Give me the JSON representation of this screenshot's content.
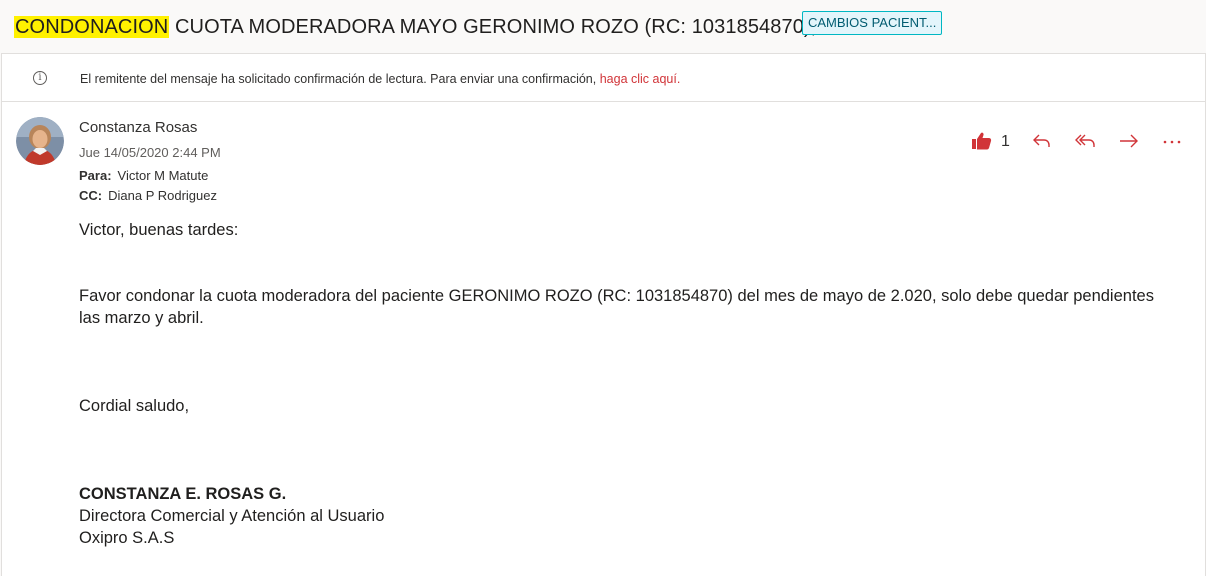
{
  "subject": {
    "highlight": "CONDONACION",
    "rest": " CUOTA MODERADORA MAYO GERONIMO ROZO (RC: 1031854870),",
    "category": "CAMBIOS PACIENT..."
  },
  "notice": {
    "icon": "info-icon",
    "text": "El remitente del mensaje ha solicitado confirmación de lectura. Para enviar una confirmación, ",
    "link": "haga clic aquí."
  },
  "message": {
    "sender": "Constanza Rosas",
    "date": "Jue 14/05/2020 2:44 PM",
    "to_label": "Para:",
    "to": "Victor M Matute",
    "cc_label": "CC:",
    "cc": "Diana P Rodriguez",
    "like_count": "1",
    "actions": [
      "like",
      "reply",
      "reply-all",
      "forward",
      "more"
    ]
  },
  "body": {
    "greeting": "Victor, buenas tardes:",
    "paragraph": "Favor condonar la cuota moderadora del paciente GERONIMO ROZO (RC: 1031854870) del mes de mayo de 2.020, solo debe quedar pendientes las marzo y abril.",
    "closing": "Cordial saludo,",
    "signature": {
      "name": "CONSTANZA E. ROSAS G.",
      "title": "Directora Comercial y Atención al Usuario",
      "company": "Oxipro S.A.S"
    }
  },
  "colors": {
    "accent": "#d13438",
    "highlight": "#fff100",
    "category_bg": "#e3f5fb",
    "category_border": "#00b7c3"
  }
}
